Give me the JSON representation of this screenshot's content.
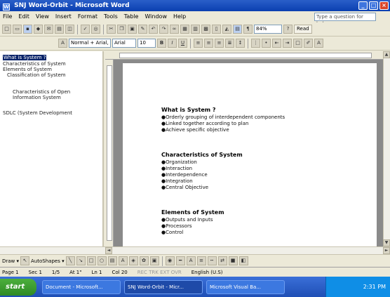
{
  "window": {
    "title": "SNJ Word-Orbit - Microsoft Word",
    "minimize": "_",
    "maximize": "□",
    "close": "×"
  },
  "menu": [
    "File",
    "Edit",
    "View",
    "Insert",
    "Format",
    "Tools",
    "Table",
    "Window",
    "Help"
  ],
  "ask_box": "Type a question for help",
  "toolbar": {
    "zoom": "84%",
    "read": "Read",
    "style": "Normal + Arial,",
    "font": "Arial",
    "size": "10"
  },
  "document_map": {
    "items": [
      {
        "label": "What is System ?",
        "selected": true
      },
      {
        "label": "Characteristics of System",
        "selected": false
      },
      {
        "label": "Elements of System",
        "selected": false
      },
      {
        "label": "Classification of System",
        "selected": false
      },
      {
        "label": "Characteristics of Open",
        "selected": false
      },
      {
        "label": "Information System",
        "selected": false
      },
      {
        "label": "SDLC (System Development",
        "selected": false
      }
    ]
  },
  "document": {
    "sections": [
      {
        "heading": "What is System ?",
        "bullets": [
          "●Orderly grouping of interdependent components",
          "●Linked together according to plan",
          "●Achieve specific objective"
        ]
      },
      {
        "heading": "Characteristics of System",
        "bullets": [
          "●Organization",
          "●Interaction",
          "●Interdependence",
          "●Integration",
          "●Central Objective"
        ]
      },
      {
        "heading": "Elements of System",
        "bullets": [
          "●Outputs and Inputs",
          "●Processors",
          "●Control"
        ]
      }
    ]
  },
  "drawbar": {
    "draw": "Draw ▾",
    "autoshapes": "AutoShapes ▾"
  },
  "status": [
    "Page 1",
    "Sec 1",
    "1/5",
    "At 1\"",
    "Ln 1",
    "Col 20",
    "REC  TRK  EXT  OVR",
    "English (U.S)"
  ],
  "taskbar": {
    "start": "start",
    "tasks": [
      "Document - Microsoft...",
      "SNJ Word-Orbit - Micr...",
      "Microsoft Visual Ba..."
    ],
    "clock": "2:31 PM"
  }
}
